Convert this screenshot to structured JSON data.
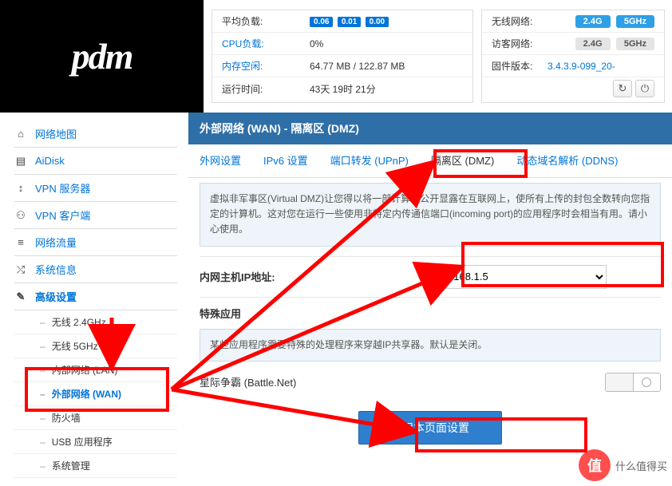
{
  "logo": "pdm",
  "stats_left": {
    "load": {
      "label": "平均负载:",
      "vals": [
        "0.06",
        "0.01",
        "0.00"
      ]
    },
    "cpu": {
      "label": "CPU负载:",
      "val": "0%"
    },
    "mem": {
      "label": "内存空闲:",
      "val": "64.77 MB / 122.87 MB"
    },
    "uptime": {
      "label": "运行时间:",
      "val": "43天 19时 21分"
    }
  },
  "stats_right": {
    "wifi": {
      "label": "无线网络:",
      "b24": "2.4G",
      "b5": "5GHz"
    },
    "guest": {
      "label": "访客网络:",
      "b24": "2.4G",
      "b5": "5GHz"
    },
    "fw": {
      "label": "固件版本:",
      "val": "3.4.3.9-099_20-"
    }
  },
  "sidebar": {
    "items": [
      {
        "icon": "home",
        "label": "网络地图"
      },
      {
        "icon": "disk",
        "label": "AiDisk"
      },
      {
        "icon": "vpn-s",
        "label": "VPN 服务器"
      },
      {
        "icon": "vpn-c",
        "label": "VPN 客户端"
      },
      {
        "icon": "traffic",
        "label": "网络流量"
      },
      {
        "icon": "sysinfo",
        "label": "系统信息"
      },
      {
        "icon": "wrench",
        "label": "高级设置"
      }
    ],
    "subs": [
      {
        "label": "无线 2.4GHz"
      },
      {
        "label": "无线 5GHz"
      },
      {
        "label": "内部网络 (LAN)"
      },
      {
        "label": "外部网络 (WAN)"
      },
      {
        "label": "防火墙"
      },
      {
        "label": "USB 应用程序"
      },
      {
        "label": "系统管理"
      }
    ]
  },
  "page": {
    "title": "外部网络 (WAN) - 隔离区 (DMZ)",
    "tabs": [
      "外网设置",
      "IPv6 设置",
      "端口转发 (UPnP)",
      "隔离区 (DMZ)",
      "动态域名解析 (DDNS)"
    ],
    "desc": "虚拟非军事区(Virtual DMZ)让您得以将一部计算机公开显露在互联网上，使所有上传的封包全数转向您指定的计算机。这对您在运行一些使用非特定内传通信端口(incoming port)的应用程序时会相当有用。请小心使用。",
    "ip_label": "内网主机IP地址:",
    "ip_value": "192.168.1.5",
    "special_title": "特殊应用",
    "special_desc": "某些应用程序需要特殊的处理程序来穿越IP共享器。默认是关闭。",
    "battlenet_label": "星际争霸 (Battle.Net)",
    "apply": "应用本页面设置"
  },
  "watermark": {
    "glyph": "值",
    "text": "什么值得买"
  }
}
